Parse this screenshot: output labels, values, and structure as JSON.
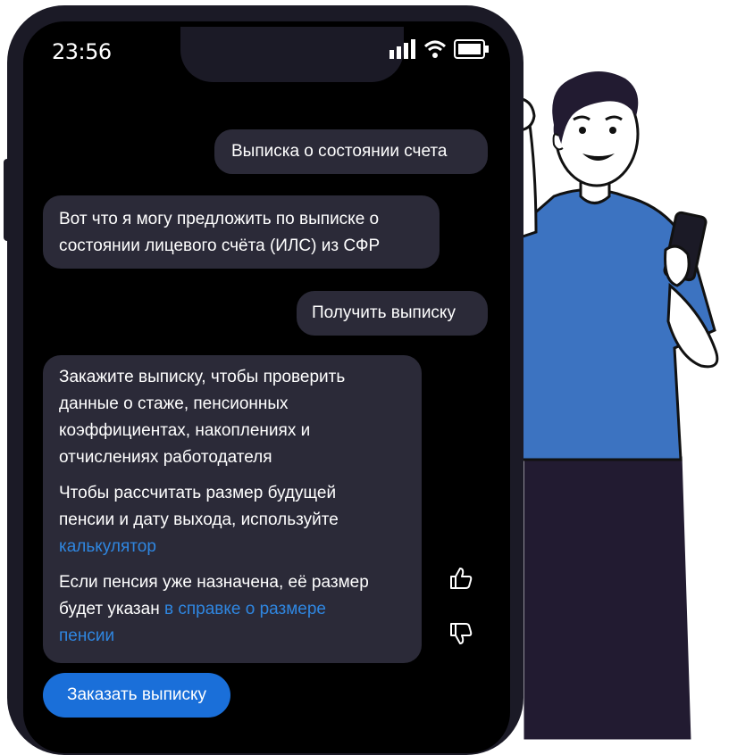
{
  "status_bar": {
    "time": "23:56"
  },
  "chat": {
    "messages": [
      {
        "from": "user",
        "text": "Выписка о состоянии счета"
      },
      {
        "from": "bot",
        "line1": "Вот что я могу предложить по выписке о",
        "line2": "состоянии лицевого счёта (ИЛС) из СФР"
      },
      {
        "from": "user",
        "text": "Получить выписку"
      }
    ],
    "reply": {
      "p1": [
        "Закажите выписку, чтобы проверить",
        "данные о стаже, пенсионных",
        "коэффициентах, накоплениях и",
        "отчислениях работодателя"
      ],
      "p2": [
        "Чтобы рассчитать размер будущей",
        "пенсии и дату выхода, используйте"
      ],
      "p2_link": "калькулятор",
      "p3_line1": "Если пенсия уже назначена, её размер",
      "p3_line2": "будет указан",
      "p3_link1": "в справке о размере",
      "p3_link2": "пенсии"
    },
    "order_button": "Заказать выписку"
  },
  "colors": {
    "bubble": "#2b2a38",
    "link": "#2f86e0",
    "button": "#1a6fd9",
    "shirt": "#3c73c1",
    "pants": "#221b31"
  },
  "icons": [
    "signal-icon",
    "wifi-icon",
    "battery-icon",
    "thumbs-up-icon",
    "thumbs-down-icon"
  ]
}
